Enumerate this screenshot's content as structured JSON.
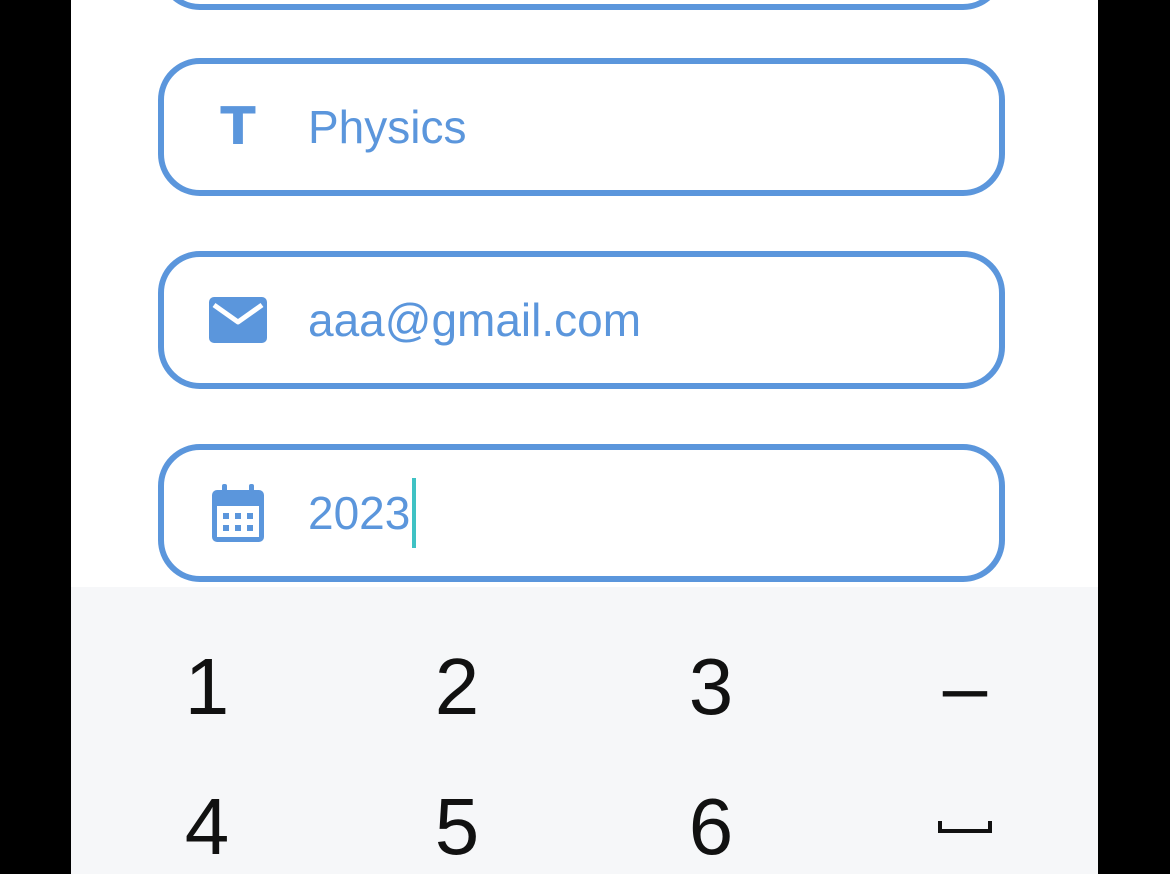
{
  "colors": {
    "accent": "#5b96dc",
    "caret": "#3fc2c4",
    "keyboard_bg": "#f6f7f9",
    "key_text": "#111111"
  },
  "form": {
    "subject": {
      "icon": "text-t-icon",
      "glyph": "T",
      "value": "Physics"
    },
    "email": {
      "icon": "mail-icon",
      "value": "aaa@gmail.com"
    },
    "year": {
      "icon": "calendar-icon",
      "value": "2023"
    }
  },
  "keyboard": {
    "keys": {
      "k1": "1",
      "k2": "2",
      "k3": "3",
      "dash": "–",
      "k4": "4",
      "k5": "5",
      "k6": "6",
      "space_icon": "space-key-icon"
    }
  }
}
